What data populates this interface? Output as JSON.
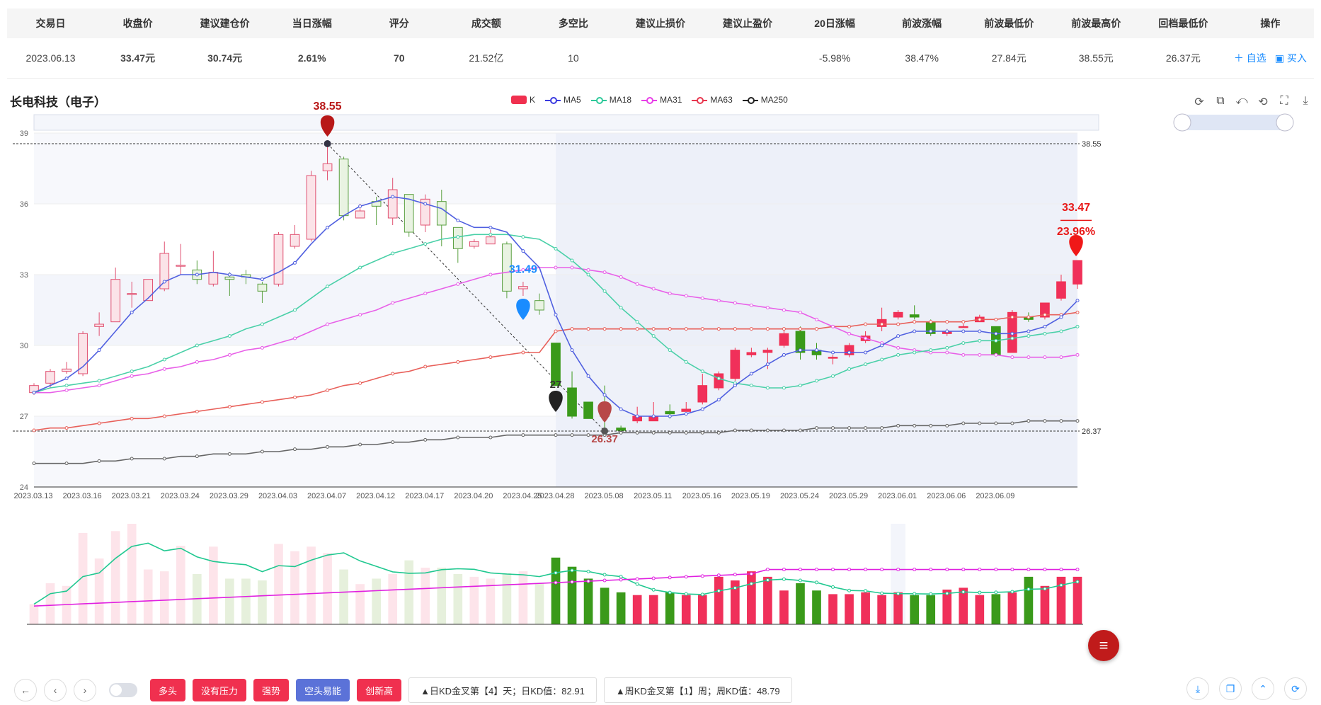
{
  "table": {
    "headers": [
      "交易日",
      "收盘价",
      "建议建仓价",
      "当日涨幅",
      "评分",
      "成交额",
      "多空比",
      "建议止损价",
      "建议止盈价",
      "20日涨幅",
      "前波涨幅",
      "前波最低价",
      "前波最高价",
      "回档最低价",
      "操作"
    ],
    "row": [
      "2023.06.13",
      "33.47元",
      "30.74元",
      "2.61%",
      "70",
      "21.52亿",
      "10",
      "",
      "",
      "-5.98%",
      "38.47%",
      "27.84元",
      "38.55元",
      "26.37元"
    ],
    "actions": {
      "watch": "＋ 自选",
      "buy": "▣ 买入"
    }
  },
  "stock_name": "长电科技（电子）",
  "legend": [
    {
      "label": "K",
      "color": "#f0304f",
      "kind": "rect"
    },
    {
      "label": "MA5",
      "color": "#3a3ae0",
      "kind": "line"
    },
    {
      "label": "MA18",
      "color": "#2ec99a",
      "kind": "line"
    },
    {
      "label": "MA31",
      "color": "#e83ee8",
      "kind": "line"
    },
    {
      "label": "MA63",
      "color": "#e8364e",
      "kind": "line"
    },
    {
      "label": "MA250",
      "color": "#222222",
      "kind": "line"
    }
  ],
  "tool_icons": [
    "refresh-icon",
    "zoom-icon",
    "zoom-back-icon",
    "restore-icon",
    "select-icon",
    "save-icon"
  ],
  "annotations": {
    "high": "38.55",
    "low": "26.37",
    "last": "33.47",
    "pct": "23.96%",
    "mid": "31.49",
    "mid2": "27",
    "line_high": "38.55",
    "line_low": "26.37"
  },
  "chart_data": {
    "type": "candlestick",
    "ylim": [
      24,
      39
    ],
    "yticks": [
      24,
      27,
      30,
      33,
      36,
      39
    ],
    "xticks": [
      "2023.03.13",
      "2023.03.16",
      "2023.03.21",
      "2023.03.24",
      "2023.03.29",
      "2023.04.03",
      "2023.04.07",
      "2023.04.12",
      "2023.04.17",
      "2023.04.20",
      "2023.04.25",
      "2023.04.28",
      "2023.05.08",
      "2023.05.11",
      "2023.05.16",
      "2023.05.19",
      "2023.05.24",
      "2023.05.29",
      "2023.06.01",
      "2023.06.06",
      "2023.06.09"
    ],
    "candles": [
      [
        28.0,
        28.3,
        27.9,
        28.4
      ],
      [
        28.4,
        28.9,
        28.2,
        29.0
      ],
      [
        28.9,
        29.0,
        28.8,
        29.3
      ],
      [
        28.8,
        30.5,
        28.7,
        30.6
      ],
      [
        30.8,
        30.9,
        30.4,
        31.4
      ],
      [
        31.0,
        32.8,
        31.0,
        33.3
      ],
      [
        32.2,
        32.2,
        31.6,
        32.7
      ],
      [
        31.9,
        32.8,
        31.9,
        32.8
      ],
      [
        32.4,
        33.9,
        32.3,
        34.4
      ],
      [
        33.4,
        33.4,
        33.0,
        34.3
      ],
      [
        33.2,
        32.8,
        32.6,
        33.6
      ],
      [
        32.6,
        33.1,
        32.5,
        34.0
      ],
      [
        32.9,
        32.8,
        32.1,
        33.1
      ],
      [
        33.0,
        32.9,
        32.6,
        33.2
      ],
      [
        32.6,
        32.3,
        31.8,
        32.7
      ],
      [
        32.6,
        34.7,
        32.5,
        34.8
      ],
      [
        34.2,
        34.7,
        34.1,
        35.1
      ],
      [
        34.5,
        37.2,
        34.4,
        37.4
      ],
      [
        37.4,
        37.7,
        37.0,
        38.6
      ],
      [
        37.9,
        35.5,
        35.3,
        38.0
      ],
      [
        35.4,
        35.7,
        35.4,
        36.0
      ],
      [
        36.1,
        35.9,
        35.1,
        36.3
      ],
      [
        35.4,
        36.6,
        35.1,
        37.1
      ],
      [
        36.4,
        34.8,
        34.6,
        36.4
      ],
      [
        35.1,
        36.2,
        34.8,
        36.4
      ],
      [
        36.1,
        35.1,
        34.2,
        36.6
      ],
      [
        35.0,
        34.1,
        33.5,
        35.0
      ],
      [
        34.2,
        34.4,
        34.1,
        34.5
      ],
      [
        34.3,
        34.6,
        34.3,
        34.9
      ],
      [
        34.3,
        32.3,
        32.0,
        34.4
      ],
      [
        32.4,
        32.5,
        32.1,
        32.7
      ],
      [
        31.9,
        31.5,
        31.3,
        32.2
      ],
      [
        30.1,
        28.3,
        28.3,
        30.1
      ],
      [
        28.2,
        27.0,
        26.9,
        28.9
      ],
      [
        27.6,
        26.9,
        26.9,
        27.6
      ],
      [
        27.3,
        27.0,
        26.5,
        28.3
      ],
      [
        26.5,
        26.4,
        26.3,
        26.6
      ],
      [
        26.8,
        27.0,
        26.7,
        27.4
      ],
      [
        26.8,
        27.0,
        26.8,
        27.6
      ],
      [
        27.2,
        27.1,
        26.9,
        27.5
      ],
      [
        27.2,
        27.3,
        27.2,
        27.6
      ],
      [
        27.6,
        28.3,
        27.5,
        28.8
      ],
      [
        28.2,
        28.8,
        28.1,
        28.9
      ],
      [
        28.6,
        29.8,
        28.5,
        29.9
      ],
      [
        29.6,
        29.7,
        29.5,
        29.9
      ],
      [
        29.7,
        29.8,
        29.0,
        29.9
      ],
      [
        30.0,
        30.5,
        29.9,
        30.7
      ],
      [
        30.6,
        29.7,
        29.4,
        30.8
      ],
      [
        29.8,
        29.6,
        29.4,
        30.1
      ],
      [
        29.5,
        29.5,
        29.2,
        29.6
      ],
      [
        29.6,
        30.0,
        29.5,
        30.1
      ],
      [
        30.2,
        30.4,
        30.1,
        30.6
      ],
      [
        30.8,
        31.1,
        30.6,
        31.6
      ],
      [
        31.2,
        31.4,
        31.1,
        31.5
      ],
      [
        31.3,
        31.2,
        31.1,
        31.7
      ],
      [
        31.0,
        30.5,
        30.4,
        31.1
      ],
      [
        30.5,
        30.6,
        30.4,
        30.7
      ],
      [
        30.8,
        30.8,
        30.8,
        30.9
      ],
      [
        31.0,
        31.2,
        31.0,
        31.3
      ],
      [
        30.8,
        29.6,
        29.6,
        30.8
      ],
      [
        29.7,
        31.4,
        29.7,
        31.5
      ],
      [
        31.2,
        31.1,
        31.0,
        31.4
      ],
      [
        31.2,
        31.8,
        31.1,
        31.8
      ],
      [
        32.0,
        32.7,
        31.9,
        33.0
      ],
      [
        32.6,
        33.6,
        32.4,
        33.6
      ]
    ],
    "ma5": [
      28.0,
      28.3,
      28.6,
      29.1,
      29.8,
      30.6,
      31.4,
      32.0,
      32.7,
      33.0,
      33.0,
      33.1,
      33.0,
      32.9,
      32.8,
      33.1,
      33.5,
      34.3,
      35.0,
      35.5,
      35.9,
      36.1,
      36.3,
      36.2,
      36.0,
      35.8,
      35.3,
      35.0,
      35.0,
      34.8,
      34.0,
      33.3,
      31.3,
      29.8,
      28.7,
      27.9,
      27.3,
      27.0,
      27.0,
      27.0,
      27.1,
      27.3,
      27.7,
      28.3,
      28.8,
      29.2,
      29.6,
      29.8,
      29.8,
      29.7,
      29.7,
      29.7,
      30.0,
      30.4,
      30.6,
      30.6,
      30.6,
      30.6,
      30.6,
      30.5,
      30.5,
      30.6,
      30.8,
      31.2,
      31.9
    ],
    "ma18": [
      28.0,
      28.2,
      28.3,
      28.4,
      28.5,
      28.7,
      28.9,
      29.1,
      29.4,
      29.7,
      30.0,
      30.2,
      30.4,
      30.7,
      30.9,
      31.2,
      31.5,
      32.0,
      32.5,
      32.9,
      33.3,
      33.6,
      33.9,
      34.1,
      34.3,
      34.5,
      34.6,
      34.7,
      34.7,
      34.7,
      34.6,
      34.5,
      34.1,
      33.6,
      33.0,
      32.3,
      31.6,
      31.0,
      30.4,
      29.8,
      29.3,
      28.9,
      28.6,
      28.4,
      28.3,
      28.2,
      28.2,
      28.3,
      28.5,
      28.7,
      29.0,
      29.2,
      29.4,
      29.6,
      29.7,
      29.8,
      29.9,
      30.1,
      30.2,
      30.2,
      30.3,
      30.4,
      30.5,
      30.6,
      30.8
    ],
    "ma31": [
      28.0,
      28.0,
      28.1,
      28.2,
      28.3,
      28.5,
      28.7,
      28.8,
      29.0,
      29.1,
      29.3,
      29.4,
      29.6,
      29.8,
      29.9,
      30.1,
      30.3,
      30.6,
      30.9,
      31.1,
      31.3,
      31.5,
      31.8,
      32.0,
      32.2,
      32.4,
      32.6,
      32.8,
      33.0,
      33.1,
      33.2,
      33.3,
      33.3,
      33.3,
      33.2,
      33.1,
      32.9,
      32.6,
      32.4,
      32.2,
      32.1,
      32.0,
      31.9,
      31.8,
      31.7,
      31.6,
      31.5,
      31.4,
      31.1,
      30.8,
      30.5,
      30.3,
      30.1,
      29.9,
      29.8,
      29.7,
      29.7,
      29.6,
      29.6,
      29.6,
      29.5,
      29.5,
      29.5,
      29.5,
      29.6
    ],
    "ma63": [
      26.4,
      26.5,
      26.5,
      26.6,
      26.7,
      26.8,
      26.9,
      26.9,
      27.0,
      27.1,
      27.2,
      27.3,
      27.4,
      27.5,
      27.6,
      27.7,
      27.8,
      27.9,
      28.1,
      28.3,
      28.4,
      28.6,
      28.8,
      28.9,
      29.1,
      29.2,
      29.3,
      29.4,
      29.5,
      29.6,
      29.7,
      29.7,
      30.6,
      30.7,
      30.7,
      30.7,
      30.7,
      30.7,
      30.7,
      30.7,
      30.7,
      30.7,
      30.7,
      30.7,
      30.7,
      30.7,
      30.7,
      30.7,
      30.7,
      30.8,
      30.8,
      30.9,
      30.9,
      30.9,
      31.0,
      31.0,
      31.0,
      31.0,
      31.1,
      31.1,
      31.2,
      31.2,
      31.3,
      31.3,
      31.4
    ],
    "ma250": [
      25.0,
      25.0,
      25.0,
      25.0,
      25.1,
      25.1,
      25.2,
      25.2,
      25.2,
      25.3,
      25.3,
      25.4,
      25.4,
      25.4,
      25.5,
      25.5,
      25.6,
      25.6,
      25.7,
      25.7,
      25.8,
      25.8,
      25.9,
      25.9,
      26.0,
      26.0,
      26.1,
      26.1,
      26.1,
      26.2,
      26.2,
      26.2,
      26.2,
      26.2,
      26.2,
      26.2,
      26.3,
      26.3,
      26.3,
      26.3,
      26.3,
      26.3,
      26.3,
      26.4,
      26.4,
      26.4,
      26.4,
      26.4,
      26.5,
      26.5,
      26.5,
      26.5,
      26.5,
      26.6,
      26.6,
      26.6,
      26.6,
      26.7,
      26.7,
      26.7,
      26.7,
      26.8,
      26.8,
      26.8,
      26.8
    ],
    "volumes": [
      22,
      45,
      42,
      100,
      72,
      102,
      110,
      60,
      58,
      86,
      55,
      85,
      50,
      50,
      48,
      88,
      80,
      85,
      78,
      60,
      44,
      50,
      55,
      70,
      62,
      62,
      55,
      52,
      50,
      56,
      58,
      45,
      73,
      63,
      50,
      40,
      35,
      32,
      32,
      35,
      32,
      32,
      52,
      48,
      58,
      52,
      37,
      45,
      37,
      33,
      33,
      35,
      32,
      35,
      32,
      32,
      38,
      40,
      32,
      33,
      35,
      52,
      42,
      52,
      52
    ]
  },
  "toolbar": {
    "tags": [
      "多头",
      "没有压力",
      "强势",
      "空头易能",
      "创新高"
    ],
    "info1": "▲日KD金叉第【4】天；日KD值：82.91",
    "info2": "▲周KD金叉第【1】周；周KD值：48.79"
  }
}
